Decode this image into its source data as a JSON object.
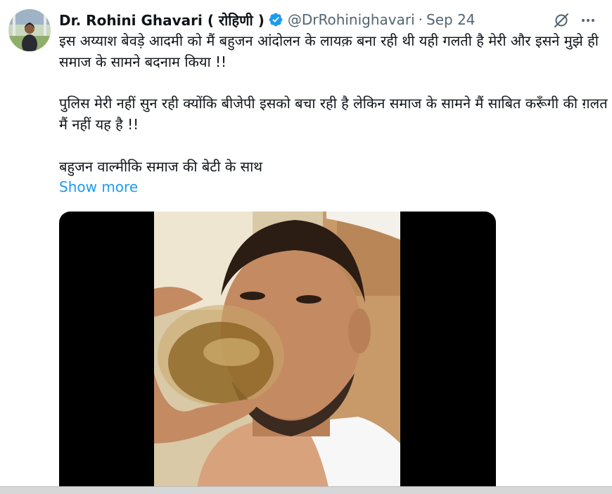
{
  "tweet": {
    "author_name": "Dr. Rohini Ghavari ( रोहिणी )",
    "handle": "@DrRohinighavari",
    "separator": "·",
    "date": "Sep 24",
    "paragraphs": [
      "इस अय्याश बेवड़े आदमी को मैं बहुजन आंदोलन के लायक़ बना रही थी यही गलती है मेरी और इसने मुझे ही समाज के सामने बदनाम किया !!",
      "पुलिस मेरी नहीं सुन रही क्योंकि बीजेपी इसको बचा रही है लेकिन समाज के सामने मैं साबित करूँगी की ग़लत मैं नहीं यह है !!",
      "बहुजन वाल्मीकि समाज की बेटी के साथ"
    ],
    "show_more_label": "Show more"
  },
  "icons": {
    "verified": "verified-badge-icon",
    "grok": "grok-icon",
    "more": "more-options-icon"
  },
  "colors": {
    "verified": "#1d9bf0",
    "link": "#1d9bf0",
    "secondary_text": "#536471"
  }
}
